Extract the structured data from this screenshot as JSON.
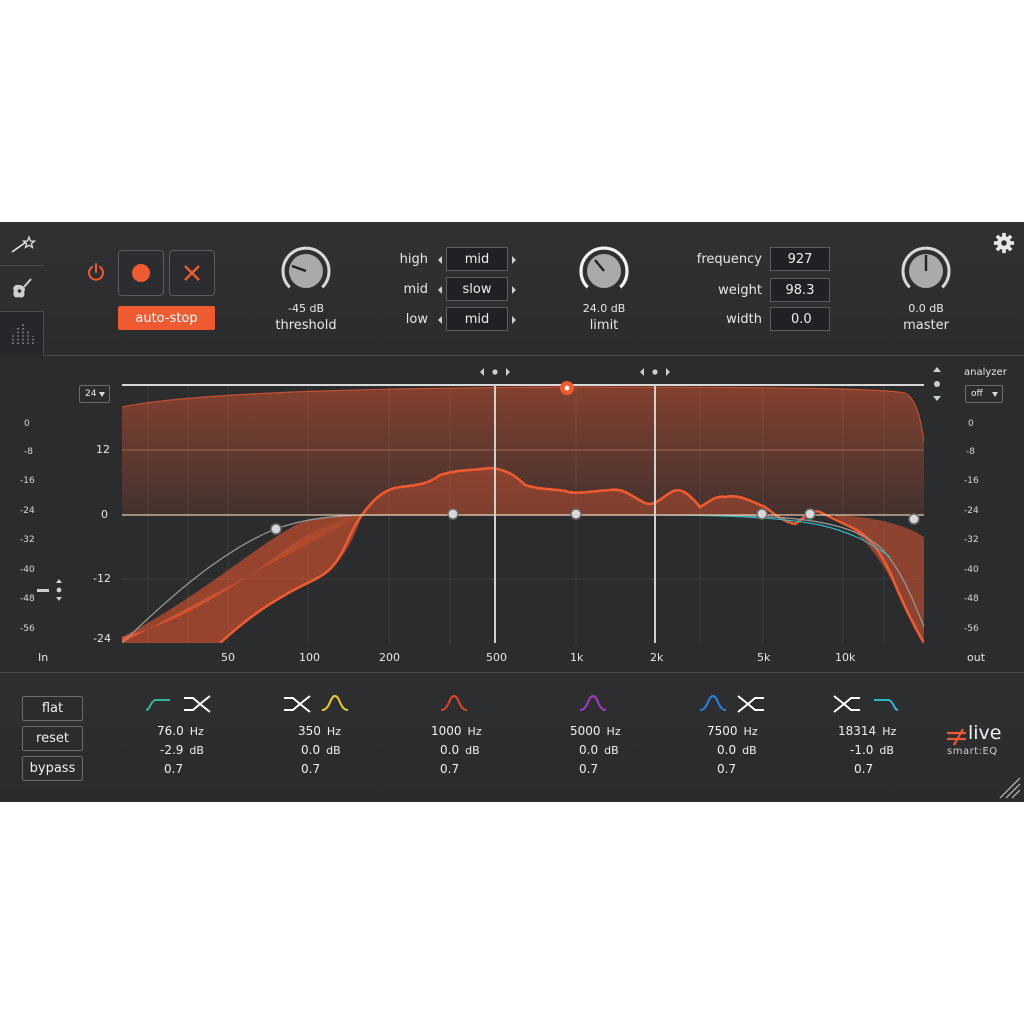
{
  "colors": {
    "accent": "#ef5a30",
    "panel": "#2a2b2d",
    "text": "#e6e6e6"
  },
  "topbar": {
    "record": {
      "power_icon": "power-icon",
      "record_icon": "record-dot-icon",
      "cancel_icon": "close-x-icon",
      "autostop_label": "auto-stop"
    },
    "threshold": {
      "value": "-45 dB",
      "label": "threshold"
    },
    "modes": [
      {
        "label": "high",
        "value": "mid"
      },
      {
        "label": "mid",
        "value": "slow"
      },
      {
        "label": "low",
        "value": "mid"
      }
    ],
    "limit": {
      "value": "24.0 dB",
      "label": "limit"
    },
    "params": [
      {
        "label": "frequency",
        "value": "927"
      },
      {
        "label": "weight",
        "value": "98.3"
      },
      {
        "label": "width",
        "value": "0.0"
      }
    ],
    "master": {
      "value": "0.0 dB",
      "label": "master"
    }
  },
  "graph": {
    "range_select": "24",
    "analyzer_label": "analyzer",
    "analyzer_value": "off",
    "gain_labels": [
      "12",
      "0",
      "-12",
      "-24"
    ],
    "meter_in_scale": [
      "0",
      "-8",
      "-16",
      "-24",
      "-32",
      "-40",
      "-48",
      "-56"
    ],
    "meter_out_scale": [
      "0",
      "-8",
      "-16",
      "-24",
      "-32",
      "-40",
      "-48",
      "-56"
    ],
    "freq_labels": [
      "50",
      "100",
      "200",
      "500",
      "1k",
      "2k",
      "5k",
      "10k"
    ],
    "in_label": "In",
    "out_label": "out"
  },
  "bottom": {
    "buttons": [
      "flat",
      "reset",
      "bypass"
    ],
    "bands": [
      {
        "freq": "76.0",
        "freq_unit": "Hz",
        "gain": "-2.9",
        "gain_unit": "dB",
        "q": "0.7",
        "color": "#33b59a",
        "icon": "low-cut-icon"
      },
      {
        "freq": "350",
        "freq_unit": "Hz",
        "gain": "0.0",
        "gain_unit": "dB",
        "q": "0.7",
        "color": "#e8cc2c",
        "icon": "bell-icon"
      },
      {
        "freq": "1000",
        "freq_unit": "Hz",
        "gain": "0.0",
        "gain_unit": "dB",
        "q": "0.7",
        "color": "#e0452a",
        "icon": "bell-icon"
      },
      {
        "freq": "5000",
        "freq_unit": "Hz",
        "gain": "0.0",
        "gain_unit": "dB",
        "q": "0.7",
        "color": "#a43ac8",
        "icon": "bell-icon"
      },
      {
        "freq": "7500",
        "freq_unit": "Hz",
        "gain": "0.0",
        "gain_unit": "dB",
        "q": "0.7",
        "color": "#2a7fe0",
        "icon": "bell-icon"
      },
      {
        "freq": "18314",
        "freq_unit": "Hz",
        "gain": "-1.0",
        "gain_unit": "dB",
        "q": "0.7",
        "color": "#2fb8c8",
        "icon": "high-cut-icon"
      }
    ],
    "brand": "live",
    "product": "smart:EQ"
  }
}
